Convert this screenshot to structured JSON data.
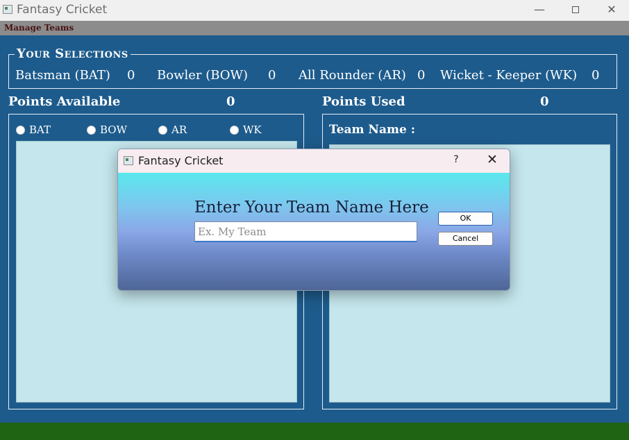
{
  "window": {
    "title": "Fantasy Cricket",
    "minimize_glyph": "—",
    "close_glyph": "✕"
  },
  "menu": {
    "manage_teams": "Manage Teams"
  },
  "selections": {
    "legend": "Your Selections",
    "batsman_label": "Batsman (BAT)",
    "batsman_count": "0",
    "bowler_label": "Bowler (BOW)",
    "bowler_count": "0",
    "allrounder_label": "All Rounder (AR)",
    "allrounder_count": "0",
    "wicketkeeper_label": "Wicket - Keeper (WK)",
    "wicketkeeper_count": "0"
  },
  "points_available": {
    "label": "Points Available",
    "value": "0"
  },
  "points_used": {
    "label": "Points Used",
    "value": "0"
  },
  "filters": [
    {
      "label": "BAT"
    },
    {
      "label": "BOW"
    },
    {
      "label": "AR"
    },
    {
      "label": "WK"
    }
  ],
  "team": {
    "name_label": "Team Name :"
  },
  "dialog": {
    "title": "Fantasy Cricket",
    "help_glyph": "?",
    "close_glyph": "✕",
    "prompt": "Enter Your Team Name Here",
    "input_value": "",
    "input_placeholder": "Ex. My Team",
    "ok_label": "OK",
    "cancel_label": "Cancel"
  },
  "colors": {
    "background": "#1d5b8c",
    "list_bg": "#c4e6ec",
    "status_bar": "#1f6412",
    "menu_bar": "#8c8c8c"
  }
}
